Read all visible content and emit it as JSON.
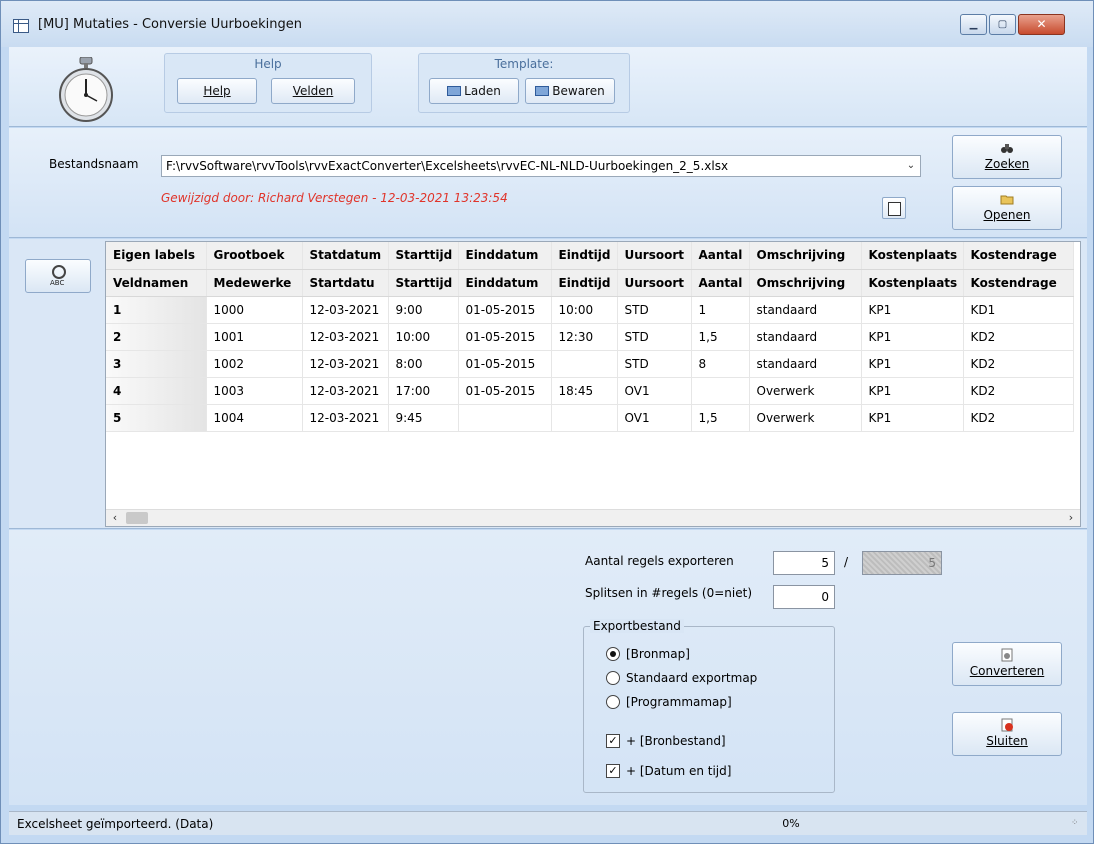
{
  "window": {
    "title": "[MU]  Mutaties - Conversie Uurboekingen",
    "controls": {
      "minimize": "▁",
      "maximize": "▢",
      "close": "✕"
    }
  },
  "toolbar": {
    "help_group": {
      "title": "Help",
      "help_label": "Help",
      "fields_label": "Velden"
    },
    "template_group": {
      "title": "Template:",
      "load_label": "Laden",
      "save_label": "Bewaren"
    }
  },
  "file": {
    "label": "Bestandsnaam",
    "path": "F:\\rvvSoftware\\rvvTools\\rvvExactConverter\\Excelsheets\\rvvEC-NL-NLD-Uurboekingen_2_5.xlsx",
    "modified": "Gewijzigd door: Richard Verstegen   -   12-03-2021  13:23:54",
    "search_label": "Zoeken",
    "open_label": "Openen"
  },
  "grid": {
    "header_labels": [
      "Eigen labels",
      "Grootboek",
      "Statdatum",
      "Starttijd",
      "Einddatum",
      "Eindtijd",
      "Uursoort",
      "Aantal",
      "Omschrijving",
      "Kostenplaats",
      "Kostendrage"
    ],
    "header_fields": [
      "Veldnamen",
      "Medewerke",
      "Startdatu",
      "Starttijd",
      "Einddatum",
      "Eindtijd",
      "Uursoort",
      "Aantal",
      "Omschrijving",
      "Kostenplaats",
      "Kostendrage"
    ],
    "rows": [
      [
        "1",
        "1000",
        "12-03-2021",
        "9:00",
        "01-05-2015",
        "10:00",
        "STD",
        "1",
        "standaard",
        "KP1",
        "KD1"
      ],
      [
        "2",
        "1001",
        "12-03-2021",
        "10:00",
        "01-05-2015",
        "12:30",
        "STD",
        "1,5",
        "standaard",
        "KP1",
        "KD2"
      ],
      [
        "3",
        "1002",
        "12-03-2021",
        "8:00",
        "01-05-2015",
        "",
        "STD",
        "8",
        "standaard",
        "KP1",
        "KD2"
      ],
      [
        "4",
        "1003",
        "12-03-2021",
        "17:00",
        "01-05-2015",
        "18:45",
        "OV1",
        "",
        "Overwerk",
        "KP1",
        "KD2"
      ],
      [
        "5",
        "1004",
        "12-03-2021",
        "9:45",
        "",
        "",
        "OV1",
        "1,5",
        "Overwerk",
        "KP1",
        "KD2"
      ]
    ]
  },
  "export": {
    "rows_label": "Aantal regels exporteren",
    "rows_value": "5",
    "separator": "/",
    "rows_total": "5",
    "split_label": "Splitsen in #regels (0=niet)",
    "split_value": "0",
    "group_title": "Exportbestand",
    "options": [
      "[Bronmap]",
      "Standaard exportmap",
      "[Programmamap]"
    ],
    "selected_option": "[Bronmap]",
    "checks": [
      "+ [Bronbestand]",
      "+ [Datum en tijd]"
    ],
    "convert_label": "Converteren",
    "close_label": "Sluiten"
  },
  "status": {
    "text": "Excelsheet geïmporteerd. (Data)",
    "progress": "0%"
  },
  "colors": {
    "accent": "#c3d9f2",
    "modified_text": "#e0342a"
  }
}
